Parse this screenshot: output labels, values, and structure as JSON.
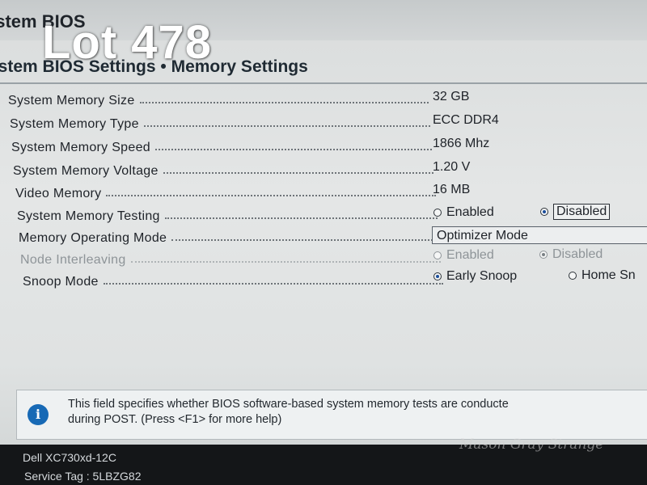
{
  "window": {
    "title": "ystem BIOS"
  },
  "overlay": {
    "lot_label": "Lot 478"
  },
  "page": {
    "header": "ystem BIOS Settings • Memory Settings"
  },
  "fields": [
    {
      "label": "System Memory Size",
      "value": "32 GB"
    },
    {
      "label": "System Memory Type",
      "value": "ECC DDR4"
    },
    {
      "label": "System Memory Speed",
      "value": "1866 Mhz"
    },
    {
      "label": "System Memory Voltage",
      "value": "1.20 V"
    },
    {
      "label": "Video Memory",
      "value": "16 MB"
    },
    {
      "label": "System Memory Testing",
      "options": [
        "Enabled",
        "Disabled"
      ],
      "selected": "Disabled"
    },
    {
      "label": "Memory Operating Mode",
      "value": "Optimizer Mode"
    },
    {
      "label": "Node Interleaving",
      "options": [
        "Enabled",
        "Disabled"
      ],
      "selected": "Disabled",
      "disabled": true
    },
    {
      "label": "Snoop Mode",
      "options": [
        "Early Snoop",
        "Home Sn"
      ],
      "selected": "Early Snoop"
    }
  ],
  "help": {
    "icon": "info-icon",
    "line1": "This field specifies whether BIOS software-based system memory tests are conducte",
    "line2": "during POST. (Press <F1> for more help)"
  },
  "footer": {
    "model": "Dell XC730xd-12C",
    "service_tag": "Service Tag : 5LBZG82"
  },
  "watermark": "Mason Gray Strange",
  "colors": {
    "accent_blue": "#1769b5",
    "footer_bg": "#141618",
    "panel_bg": "#e4e6e6"
  }
}
